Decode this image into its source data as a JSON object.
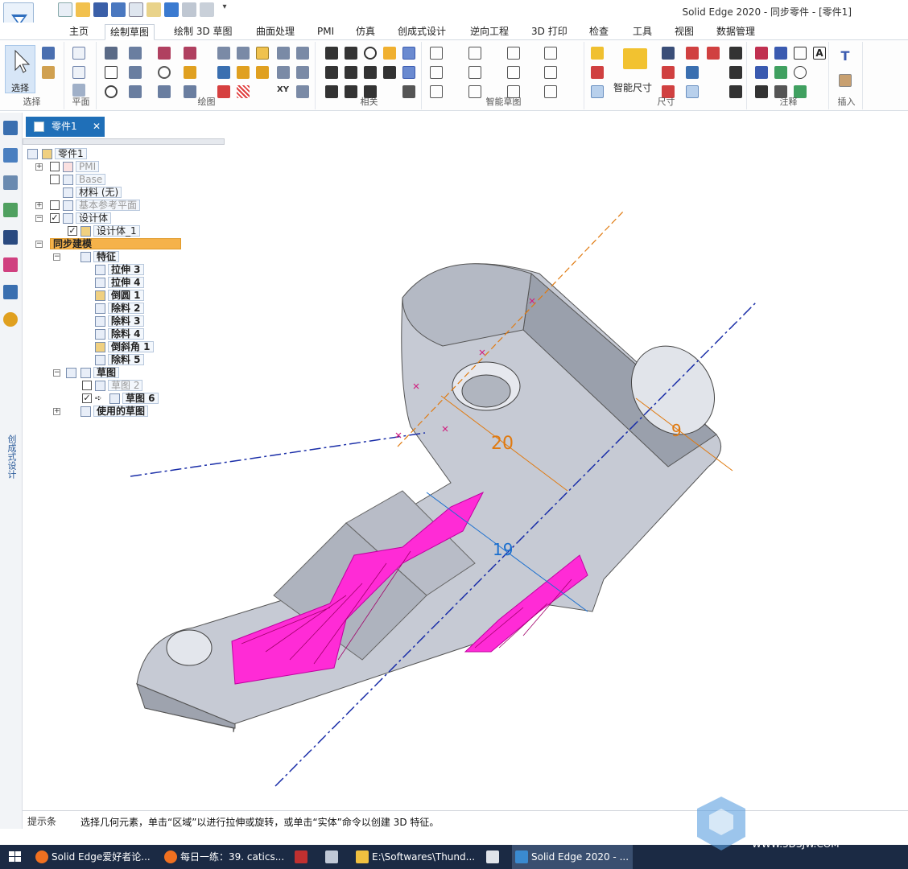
{
  "window": {
    "title": "Solid Edge 2020 - 同步零件 - [零件1]"
  },
  "tabs": [
    {
      "label": "主页"
    },
    {
      "label": "绘制草图"
    },
    {
      "label": "绘制 3D 草图"
    },
    {
      "label": "曲面处理"
    },
    {
      "label": "PMI"
    },
    {
      "label": "仿真"
    },
    {
      "label": "创成式设计"
    },
    {
      "label": "逆向工程"
    },
    {
      "label": "3D 打印"
    },
    {
      "label": "检查"
    },
    {
      "label": "工具"
    },
    {
      "label": "视图"
    },
    {
      "label": "数据管理"
    }
  ],
  "ribbon": {
    "select_label": "选择",
    "groups": {
      "select": "选择",
      "plane": "平面",
      "draw": "绘图",
      "relate": "相关",
      "intellisketch": "智能草图",
      "dimension": "尺寸",
      "annotation": "注释",
      "insert": "插入"
    },
    "smart_dim_label": "智能尺寸"
  },
  "left_toolbar": {
    "vertical_label": "创成式设计"
  },
  "document_tab": {
    "label": "零件1"
  },
  "tree": {
    "root": "零件1",
    "pmi": "PMI",
    "base": "Base",
    "material": "材料 (无)",
    "base_planes": "基本参考平面",
    "design_body": "设计体",
    "design_body_1": "设计体_1",
    "sync_model": "同步建模",
    "features": "特征",
    "feature_items": [
      "拉伸 3",
      "拉伸 4",
      "倒圆 1",
      "除料 2",
      "除料 3",
      "除料 4",
      "倒斜角 1",
      "除料 5"
    ],
    "sketches": "草图",
    "sketch2": "草图 2",
    "sketch6": "草图 6",
    "used_sketches": "使用的草图"
  },
  "viewport": {
    "dim_20": "20",
    "dim_9": "9",
    "dim_19": "19",
    "colors": {
      "part": "#c8ccd6",
      "section": "#ff2bd6",
      "dim_orange": "#e07a10",
      "axis_blue": "#1a2ea8",
      "dim_blue": "#1a6fcf"
    }
  },
  "status": {
    "tag": "提示条",
    "text": "选择几何元素，单击“区域”以进行拉伸或旋转，或单击“实体”命令以创建 3D 特征。"
  },
  "taskbar": {
    "items": [
      "Solid Edge爱好者论...",
      "每日一练：39. catics...",
      "",
      "",
      "E:\\Softwares\\Thund...",
      "",
      "Solid Edge 2020 - ..."
    ]
  },
  "watermark": {
    "url": "WWW.3DSJW.COM"
  }
}
